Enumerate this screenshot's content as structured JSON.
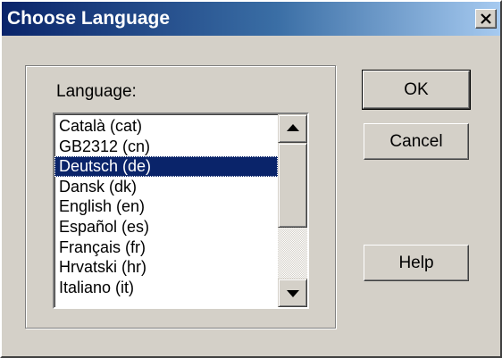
{
  "window": {
    "title": "Choose Language",
    "close_label": "close"
  },
  "language_label": "Language:",
  "languages": [
    "Català (cat)",
    "GB2312 (cn)",
    "Deutsch (de)",
    "Dansk (dk)",
    "English (en)",
    "Español (es)",
    "Français (fr)",
    "Hrvatski (hr)",
    "Italiano (it)"
  ],
  "selected_language": "Deutsch (de)",
  "buttons": {
    "ok": "OK",
    "cancel": "Cancel",
    "help": "Help"
  },
  "icons": {
    "close": "close-icon",
    "scroll_up": "arrow-up-icon",
    "scroll_down": "arrow-down-icon"
  },
  "colors": {
    "title_start": "#0a246a",
    "title_end": "#a6caf0",
    "face": "#d4d0c8",
    "selection": "#0a246a"
  }
}
